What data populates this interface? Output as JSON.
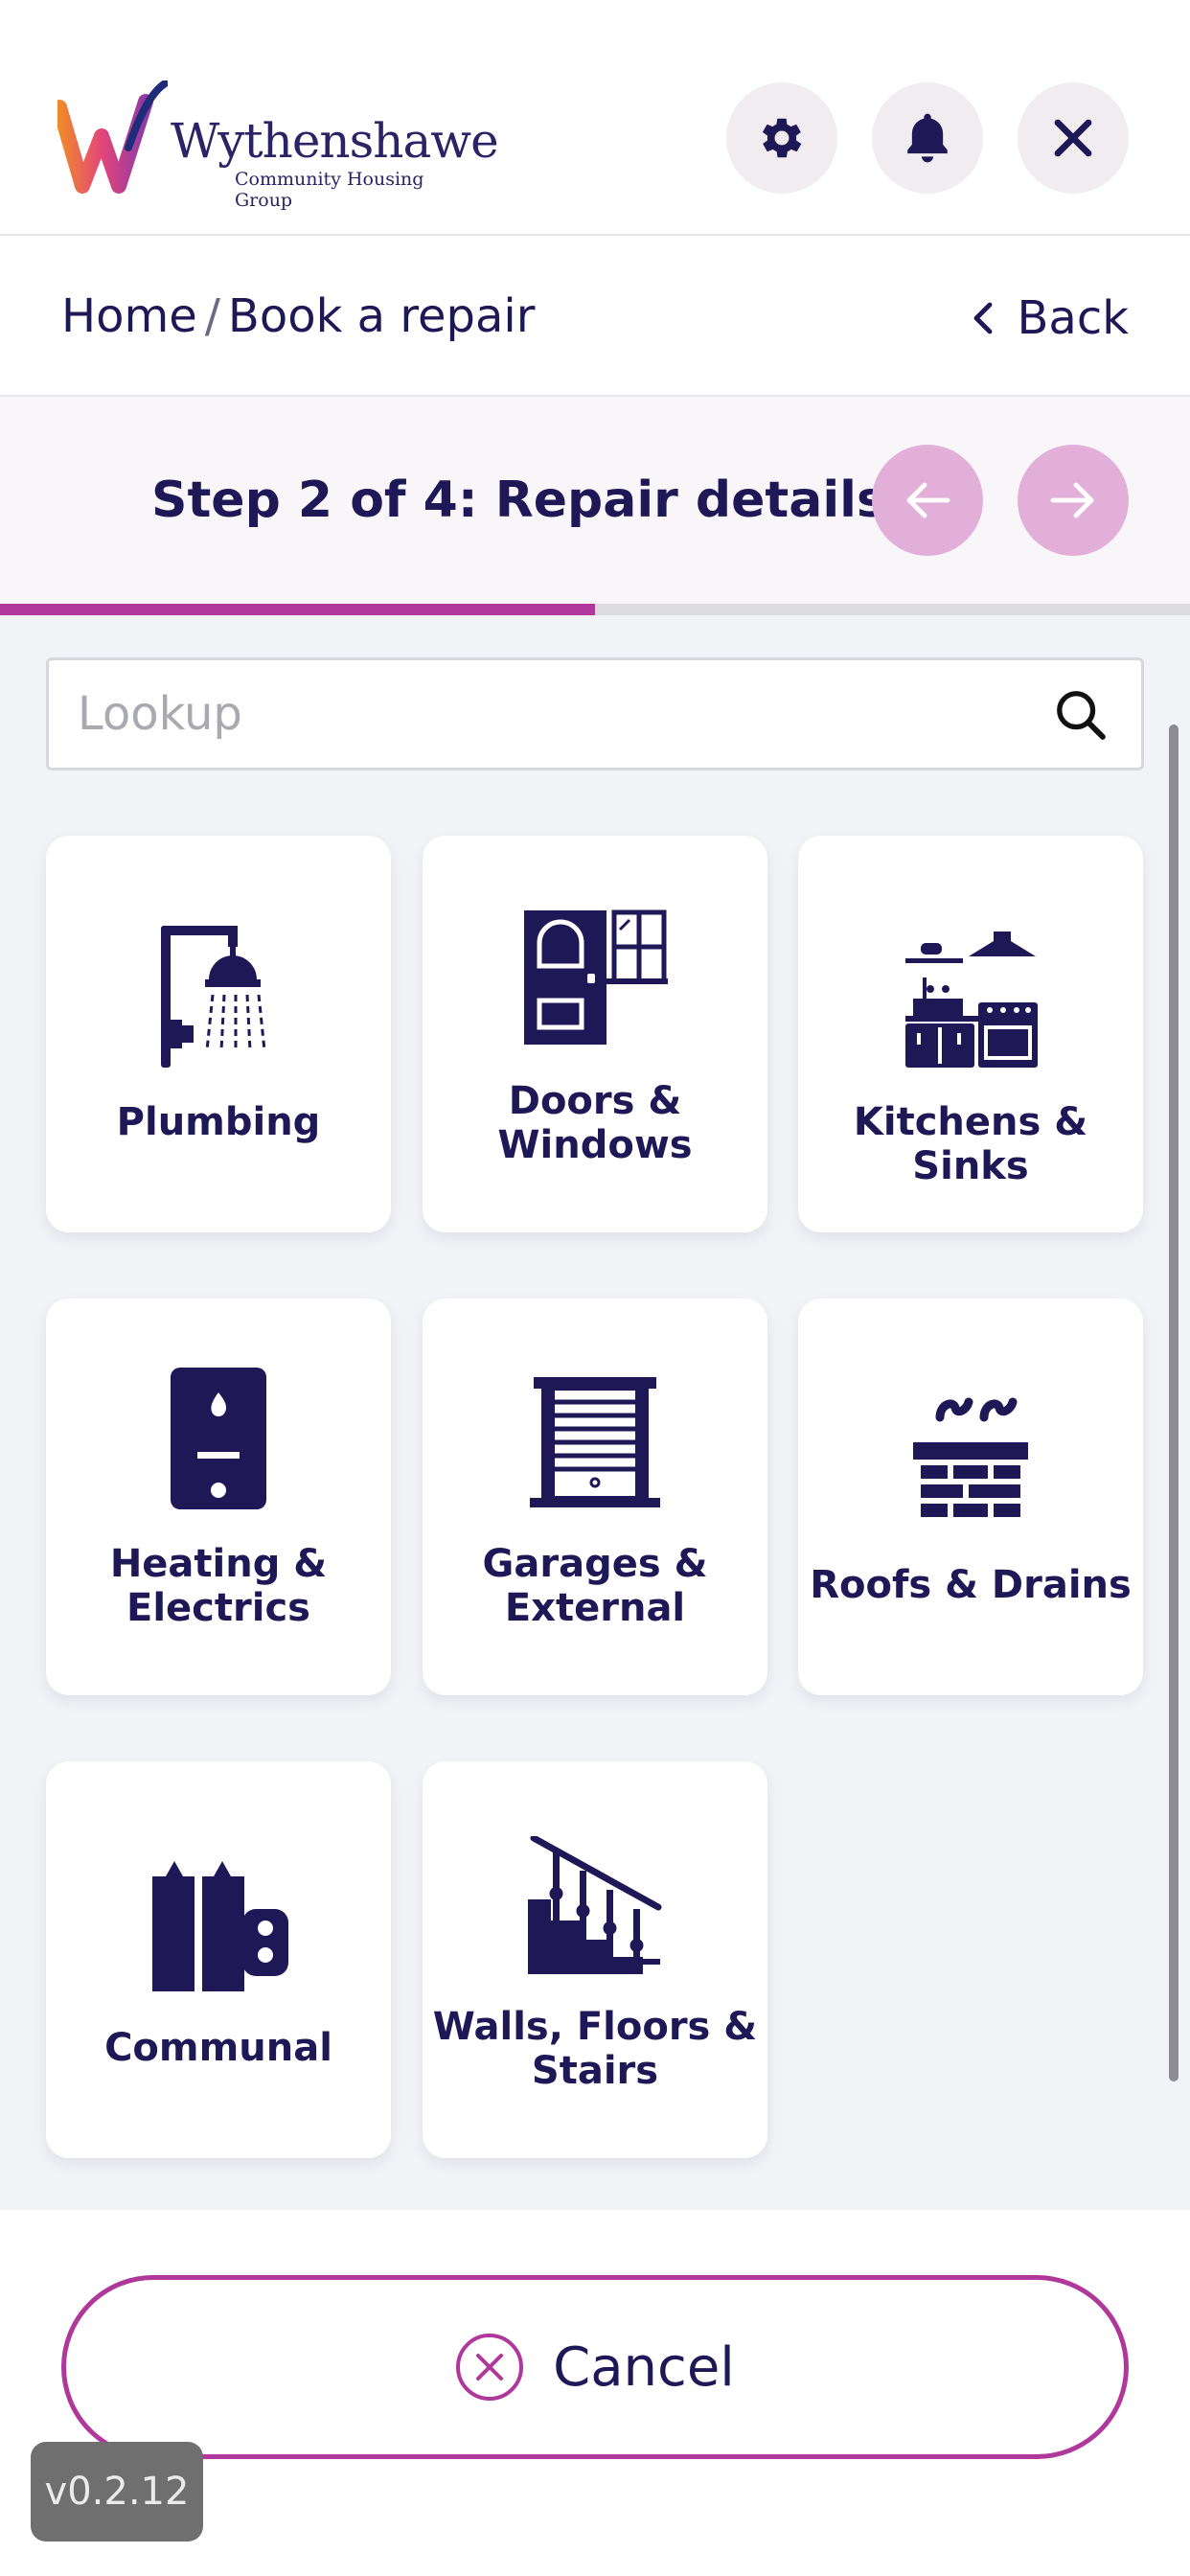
{
  "brand": {
    "name": "Wythenshawe",
    "tagline": "Community Housing Group",
    "colors": {
      "navy": "#1e1857",
      "magenta": "#b0389a",
      "pink": "#e2afd9"
    }
  },
  "header": {
    "settings_icon": "gear-icon",
    "notifications_icon": "bell-icon",
    "close_icon": "close-icon"
  },
  "breadcrumb": {
    "home": "Home",
    "separator": "/",
    "current": "Book a repair",
    "back_label": "Back"
  },
  "step": {
    "title": "Step 2 of 4: Repair details",
    "current": 2,
    "total": 4,
    "progress": 0.5
  },
  "lookup": {
    "placeholder": "Lookup"
  },
  "categories": [
    {
      "label_line1": "Plumbing",
      "label_line2": "",
      "icon": "shower-icon"
    },
    {
      "label_line1": "Doors &",
      "label_line2": "Windows",
      "icon": "door-window-icon"
    },
    {
      "label_line1": "Kitchens & Sinks",
      "label_line2": "",
      "icon": "kitchen-icon"
    },
    {
      "label_line1": "Heating &",
      "label_line2": "Electrics",
      "icon": "boiler-icon"
    },
    {
      "label_line1": "Garages &",
      "label_line2": "External",
      "icon": "garage-icon"
    },
    {
      "label_line1": "Roofs & Drains",
      "label_line2": "",
      "icon": "chimney-icon"
    },
    {
      "label_line1": "Communal",
      "label_line2": "",
      "icon": "communal-icon"
    },
    {
      "label_line1": "Walls, Floors &",
      "label_line2": "Stairs",
      "icon": "stairs-icon"
    }
  ],
  "footer": {
    "cancel_label": "Cancel",
    "version": "v0.2.12"
  }
}
